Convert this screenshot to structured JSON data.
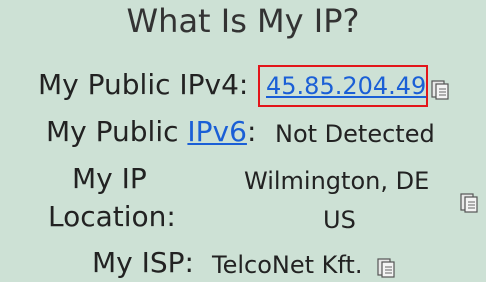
{
  "title": "What Is My IP?",
  "ipv4": {
    "label": "My Public IPv4:",
    "value": "45.85.204.49"
  },
  "ipv6": {
    "label_prefix": "My Public",
    "link": "IPv6",
    "colon": ":",
    "value": "Not Detected"
  },
  "location": {
    "label_line1": "My IP",
    "label_line2": "Location:",
    "value_line1": "Wilmington, DE",
    "value_line2": "US"
  },
  "isp": {
    "label": "My ISP:",
    "value": "TelcoNet Kft."
  },
  "colors": {
    "background": "#cde1d5",
    "link": "#1a5fd6",
    "highlight": "#e3151a"
  },
  "icons": {
    "copy": "copy-clipboard-icon"
  }
}
